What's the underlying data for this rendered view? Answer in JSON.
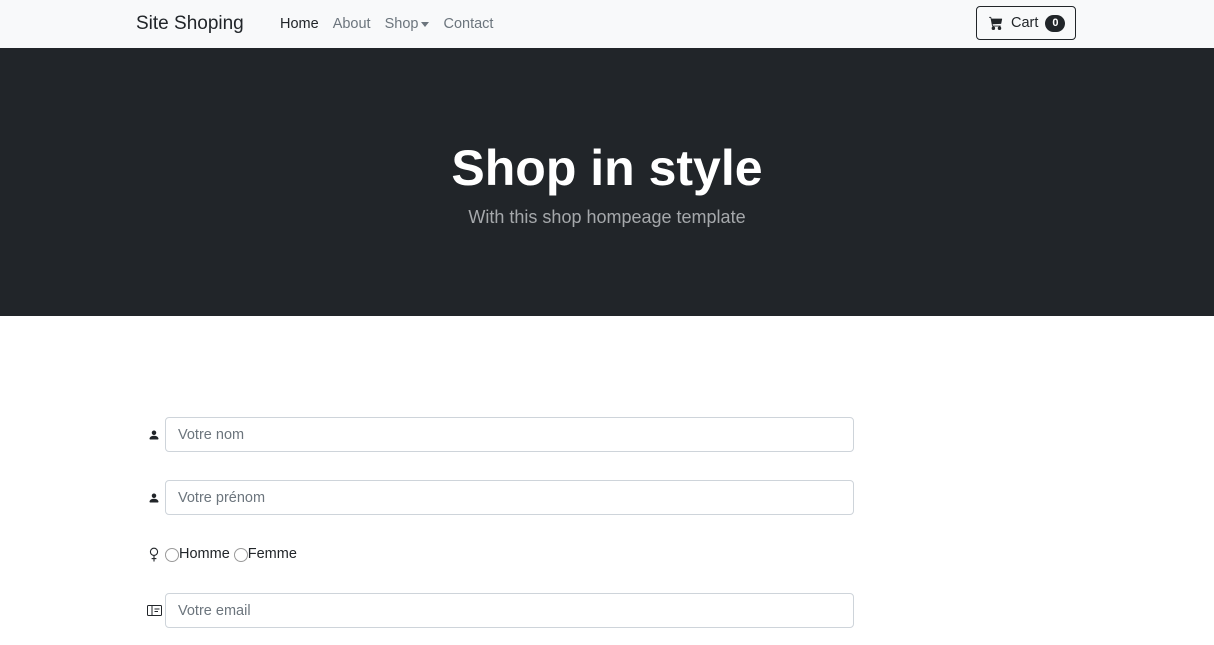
{
  "navbar": {
    "brand": "Site Shoping",
    "links": [
      "Home",
      "About",
      "Shop",
      "Contact"
    ],
    "cart_label": "Cart",
    "cart_count": "0"
  },
  "hero": {
    "title": "Shop in style",
    "subtitle": "With this shop hompeage template"
  },
  "form": {
    "nom_placeholder": "Votre nom",
    "prenom_placeholder": "Votre prénom",
    "gender_options": [
      "Homme",
      "Femme"
    ],
    "email_placeholder": "Votre email"
  },
  "icons": {
    "cart": "cart-icon",
    "person": "person-icon",
    "gender": "female-symbol-icon",
    "email": "envelope-icon"
  },
  "colors": {
    "hero_bg": "#212529",
    "navbar_bg": "#f8f9fa",
    "accent": "#212529"
  }
}
